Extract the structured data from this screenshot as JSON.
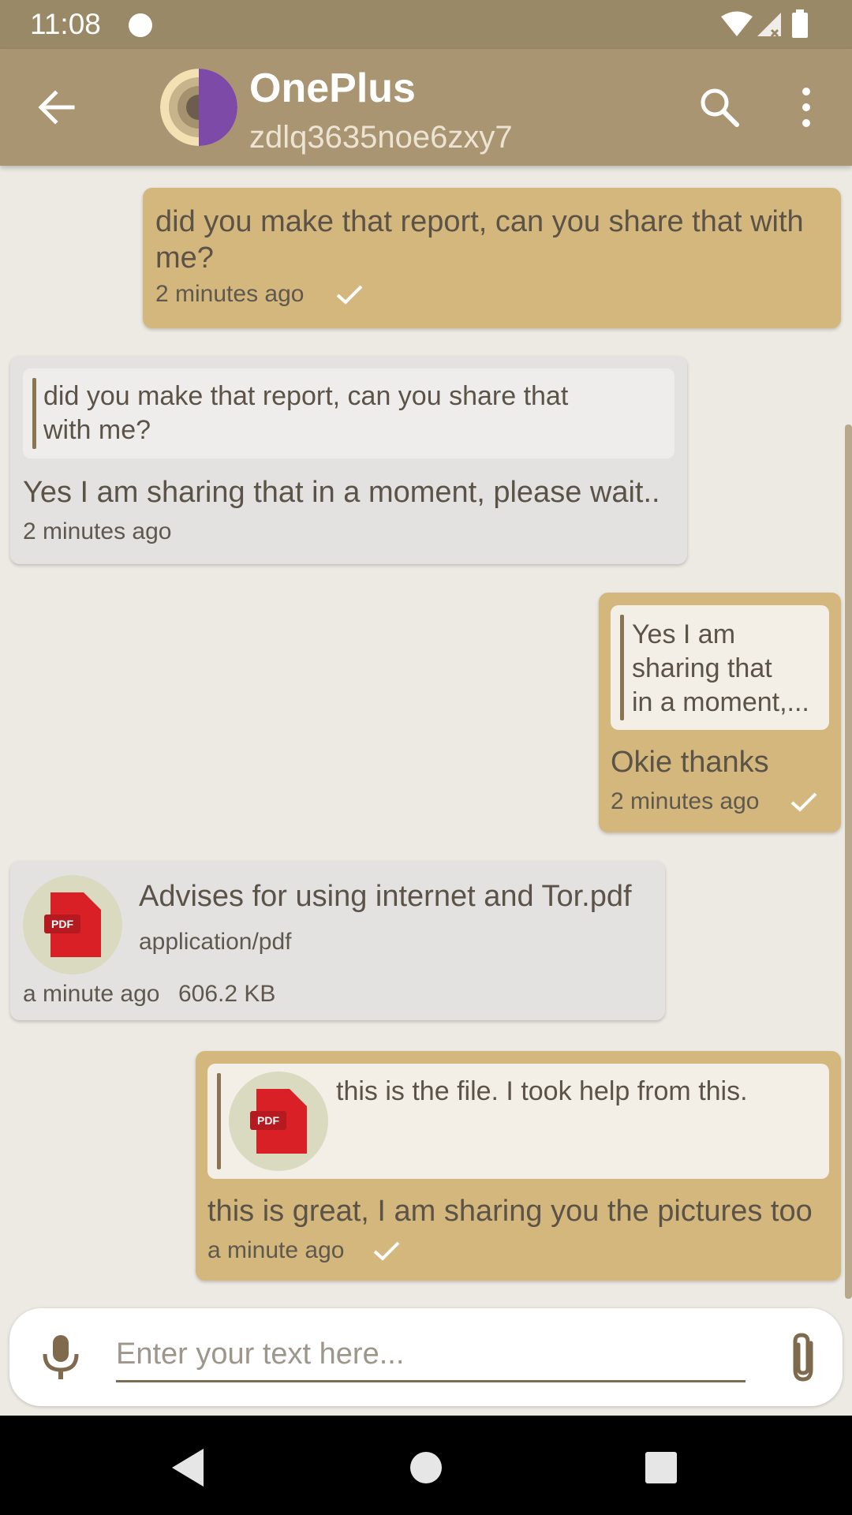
{
  "status_bar": {
    "time": "11:08"
  },
  "header": {
    "title": "OnePlus",
    "subtitle": "zdlq3635noe6zxy7"
  },
  "messages": [
    {
      "direction": "out",
      "text_line1": "did you make that report, can you share that with",
      "text_line2": "me?",
      "time": "2 minutes ago",
      "status": "sent"
    },
    {
      "direction": "in",
      "quote_line1": "did you make that report, can you share that",
      "quote_line2": "with me?",
      "text": "Yes I am sharing that in a moment, please wait..",
      "time": "2 minutes ago"
    },
    {
      "direction": "out",
      "quote_line1": "Yes I am",
      "quote_line2": "sharing that",
      "quote_line3": "in a moment,...",
      "text": "Okie thanks",
      "time": "2 minutes ago",
      "status": "sent"
    },
    {
      "direction": "in",
      "file_name": "Advises for using internet and Tor.pdf",
      "file_type": "application/pdf",
      "time": "a minute ago",
      "file_size": "606.2 KB",
      "file_badge": "PDF"
    },
    {
      "direction": "out",
      "quote_text": "this is the file. I took help from this.",
      "quote_badge": "PDF",
      "text": "this is great, I am sharing you the pictures too",
      "time": "a minute ago",
      "status": "sent"
    }
  ],
  "composer": {
    "placeholder": "Enter your text here..."
  },
  "colors": {
    "app_bar": "#a99571",
    "status_bar": "#9a8967",
    "outgoing_bubble": "#d4b77c",
    "incoming_bubble": "#e4e2e0",
    "background": "#edeae4",
    "pdf_red": "#d92027"
  },
  "icons": {
    "back": "arrow-left-icon",
    "search": "search-icon",
    "more": "more-vert-icon",
    "mic": "microphone-icon",
    "attach": "paperclip-icon",
    "check": "check-icon",
    "pdf": "pdf-file-icon"
  }
}
